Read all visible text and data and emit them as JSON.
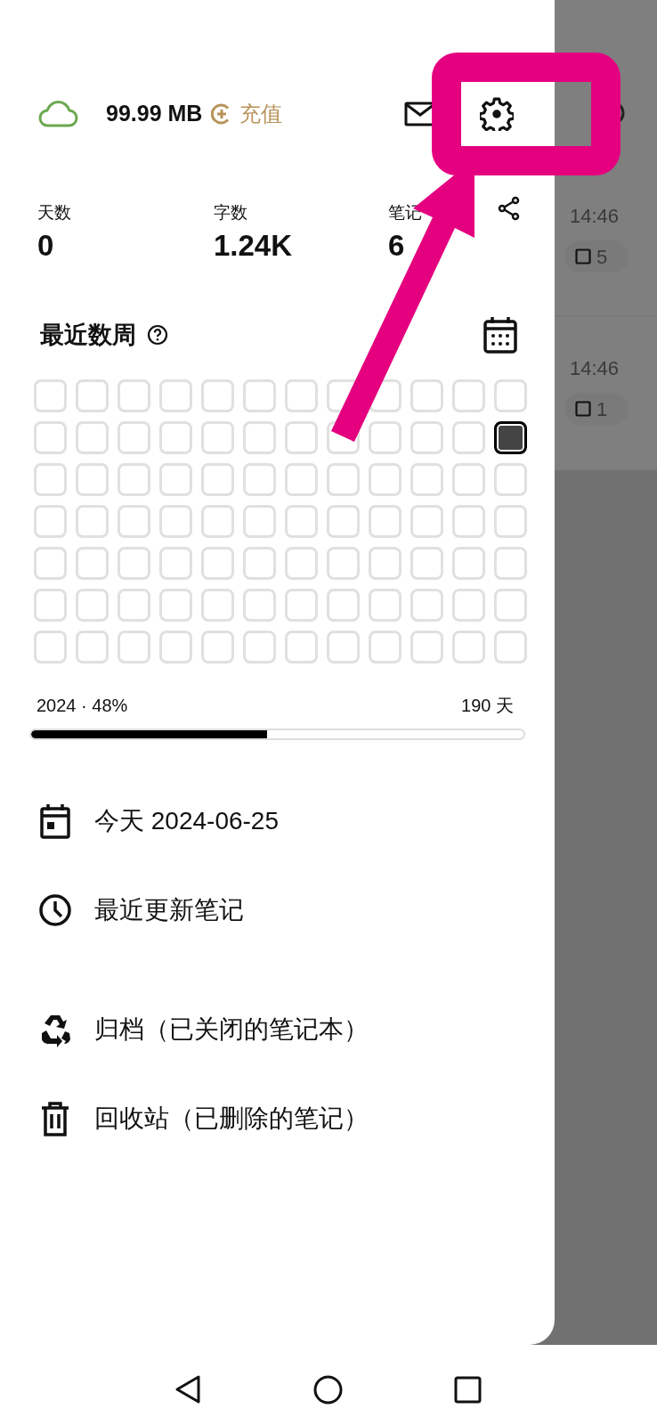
{
  "storage": {
    "amount": "99.99 MB",
    "recharge": "充值"
  },
  "stats": [
    {
      "label": "天数",
      "value": "0"
    },
    {
      "label": "字数",
      "value": "1.24K"
    },
    {
      "label": "笔记",
      "value": "6"
    }
  ],
  "recent_weeks": {
    "title": "最近数周",
    "grid": [
      [
        {
          "active": false
        },
        {
          "active": false
        },
        {
          "active": false
        },
        {
          "active": false
        },
        {
          "active": false
        },
        {
          "active": false
        },
        {
          "active": false
        },
        {
          "active": false
        },
        {
          "active": false
        },
        {
          "active": false
        },
        {
          "active": false
        },
        {
          "active": false
        }
      ],
      [
        {
          "active": false
        },
        {
          "active": false
        },
        {
          "active": false
        },
        {
          "active": false
        },
        {
          "active": false
        },
        {
          "active": false
        },
        {
          "active": false
        },
        {
          "active": false
        },
        {
          "active": false
        },
        {
          "active": false
        },
        {
          "active": false
        },
        {
          "active": true
        }
      ],
      [
        {
          "active": false
        },
        {
          "active": false
        },
        {
          "active": false
        },
        {
          "active": false
        },
        {
          "active": false
        },
        {
          "active": false
        },
        {
          "active": false
        },
        {
          "active": false
        },
        {
          "active": false
        },
        {
          "active": false
        },
        {
          "active": false
        },
        {
          "active": false
        }
      ],
      [
        {
          "active": false
        },
        {
          "active": false
        },
        {
          "active": false
        },
        {
          "active": false
        },
        {
          "active": false
        },
        {
          "active": false
        },
        {
          "active": false
        },
        {
          "active": false
        },
        {
          "active": false
        },
        {
          "active": false
        },
        {
          "active": false
        },
        {
          "active": false
        }
      ],
      [
        {
          "active": false
        },
        {
          "active": false
        },
        {
          "active": false
        },
        {
          "active": false
        },
        {
          "active": false
        },
        {
          "active": false
        },
        {
          "active": false
        },
        {
          "active": false
        },
        {
          "active": false
        },
        {
          "active": false
        },
        {
          "active": false
        },
        {
          "active": false
        }
      ],
      [
        {
          "active": false
        },
        {
          "active": false
        },
        {
          "active": false
        },
        {
          "active": false
        },
        {
          "active": false
        },
        {
          "active": false
        },
        {
          "active": false
        },
        {
          "active": false
        },
        {
          "active": false
        },
        {
          "active": false
        },
        {
          "active": false
        },
        {
          "active": false
        }
      ],
      [
        {
          "active": false
        },
        {
          "active": false
        },
        {
          "active": false
        },
        {
          "active": false
        },
        {
          "active": false
        },
        {
          "active": false
        },
        {
          "active": false
        },
        {
          "active": false
        },
        {
          "active": false
        },
        {
          "active": false
        },
        {
          "active": false
        },
        {
          "active": false
        }
      ]
    ]
  },
  "year_progress": {
    "label": "2024 · 48%",
    "days": "190 天",
    "level": 0.48
  },
  "menu_sections": [
    [
      {
        "kind": "today",
        "label": "今天 2024-06-25"
      },
      {
        "kind": "recent",
        "label": "最近更新笔记"
      }
    ],
    [
      {
        "kind": "archive",
        "label": "归档（已关闭的笔记本）"
      },
      {
        "kind": "trash",
        "label": "回收站（已删除的笔记）"
      }
    ]
  ],
  "background_list": [
    {
      "time": "14:46",
      "count": "5"
    },
    {
      "time": "14:46",
      "count": "1"
    }
  ]
}
